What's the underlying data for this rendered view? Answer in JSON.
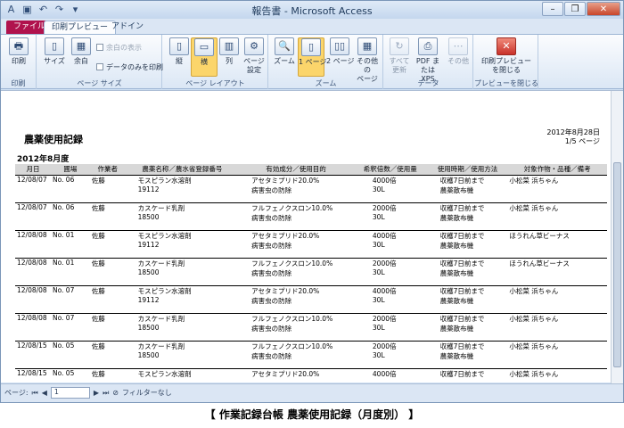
{
  "window": {
    "title": "報告書 - Microsoft Access",
    "tabs": [
      "ファイル",
      "印刷プレビュー",
      "アドイン"
    ],
    "controls": [
      "–",
      "❐",
      "✕"
    ]
  },
  "ribbon": {
    "print_group": {
      "button": "印刷",
      "label": "印刷"
    },
    "page_size_group": {
      "size": "サイズ",
      "margin": "余白",
      "show_margin": "余白の表示",
      "data_only": "データのみを印刷",
      "label": "ページ サイズ"
    },
    "layout_group": {
      "portrait": "縦",
      "landscape": "横",
      "columns": "列",
      "page_setup": "ページ\n設定",
      "label": "ページ レイアウト"
    },
    "zoom_group": {
      "zoom": "ズーム",
      "one_page": "1 ページ",
      "two_pages": "2 ページ",
      "more_pages": "その他の\nページ",
      "label": "ズーム"
    },
    "data_group": {
      "refresh_all": "すべて\n更新",
      "pdf_xps": "PDF または\nXPS",
      "more": "その他",
      "label": "データ"
    },
    "close_group": {
      "close_preview": "印刷プレビュー\nを閉じる",
      "label": "プレビューを閉じる"
    }
  },
  "report": {
    "title": "農薬使用記録",
    "date": "2012年8月28日",
    "page": "1/5 ページ",
    "month": "2012年8月度",
    "columns": [
      "月日",
      "圃場",
      "作業者",
      "農薬名称／農水省登録番号",
      "有効成分／使用目的",
      "希釈倍数／使用量",
      "使用時期／使用方法",
      "対象作物・品種／備考"
    ],
    "rows": [
      {
        "date": "12/08/07",
        "field": "No. 06",
        "worker": "佐藤",
        "pesticide": "モスピラン水溶剤",
        "reg_no": "19112",
        "ingredient": "アセタミプリド20.0%",
        "purpose": "病害虫の防除",
        "dilution": "4000倍",
        "amount": "30L",
        "timing": "収穫7日前まで",
        "method": "農薬散布機",
        "crop": "小松菜 浜ちゃん"
      },
      {
        "date": "12/08/07",
        "field": "No. 06",
        "worker": "佐藤",
        "pesticide": "カスケード乳剤",
        "reg_no": "18500",
        "ingredient": "フルフェノクスロン10.0%",
        "purpose": "病害虫の防除",
        "dilution": "2000倍",
        "amount": "30L",
        "timing": "収穫7日前まで",
        "method": "農薬散布機",
        "crop": "小松菜 浜ちゃん"
      },
      {
        "date": "12/08/08",
        "field": "No. 01",
        "worker": "佐藤",
        "pesticide": "モスピラン水溶剤",
        "reg_no": "19112",
        "ingredient": "アセタミプリド20.0%",
        "purpose": "病害虫の防除",
        "dilution": "4000倍",
        "amount": "30L",
        "timing": "収穫7日前まで",
        "method": "農薬散布機",
        "crop": "ほうれん草ビーナス"
      },
      {
        "date": "12/08/08",
        "field": "No. 01",
        "worker": "佐藤",
        "pesticide": "カスケード乳剤",
        "reg_no": "18500",
        "ingredient": "フルフェノクスロン10.0%",
        "purpose": "病害虫の防除",
        "dilution": "2000倍",
        "amount": "30L",
        "timing": "収穫7日前まで",
        "method": "農薬散布機",
        "crop": "ほうれん草ビーナス"
      },
      {
        "date": "12/08/08",
        "field": "No. 07",
        "worker": "佐藤",
        "pesticide": "モスピラン水溶剤",
        "reg_no": "19112",
        "ingredient": "アセタミプリド20.0%",
        "purpose": "病害虫の防除",
        "dilution": "4000倍",
        "amount": "30L",
        "timing": "収穫7日前まで",
        "method": "農薬散布機",
        "crop": "小松菜 浜ちゃん"
      },
      {
        "date": "12/08/08",
        "field": "No. 07",
        "worker": "佐藤",
        "pesticide": "カスケード乳剤",
        "reg_no": "18500",
        "ingredient": "フルフェノクスロン10.0%",
        "purpose": "病害虫の防除",
        "dilution": "2000倍",
        "amount": "30L",
        "timing": "収穫7日前まで",
        "method": "農薬散布機",
        "crop": "小松菜 浜ちゃん"
      },
      {
        "date": "12/08/15",
        "field": "No. 05",
        "worker": "佐藤",
        "pesticide": "カスケード乳剤",
        "reg_no": "18500",
        "ingredient": "フルフェノクスロン10.0%",
        "purpose": "病害虫の防除",
        "dilution": "2000倍",
        "amount": "30L",
        "timing": "収穫7日前まで",
        "method": "農薬散布機",
        "crop": "小松菜 浜ちゃん"
      },
      {
        "date": "12/08/15",
        "field": "No. 05",
        "worker": "佐藤",
        "pesticide": "モスピラン水溶剤",
        "reg_no": "",
        "ingredient": "アセタミプリド20.0%",
        "purpose": "",
        "dilution": "4000倍",
        "amount": "",
        "timing": "収穫7日前まで",
        "method": "",
        "crop": "小松菜 浜ちゃん"
      }
    ]
  },
  "status": {
    "page_label": "ページ:",
    "page_value": "1",
    "filter": "フィルターなし"
  },
  "caption": "【 作業記録台帳 農薬使用記録（月度別） 】"
}
